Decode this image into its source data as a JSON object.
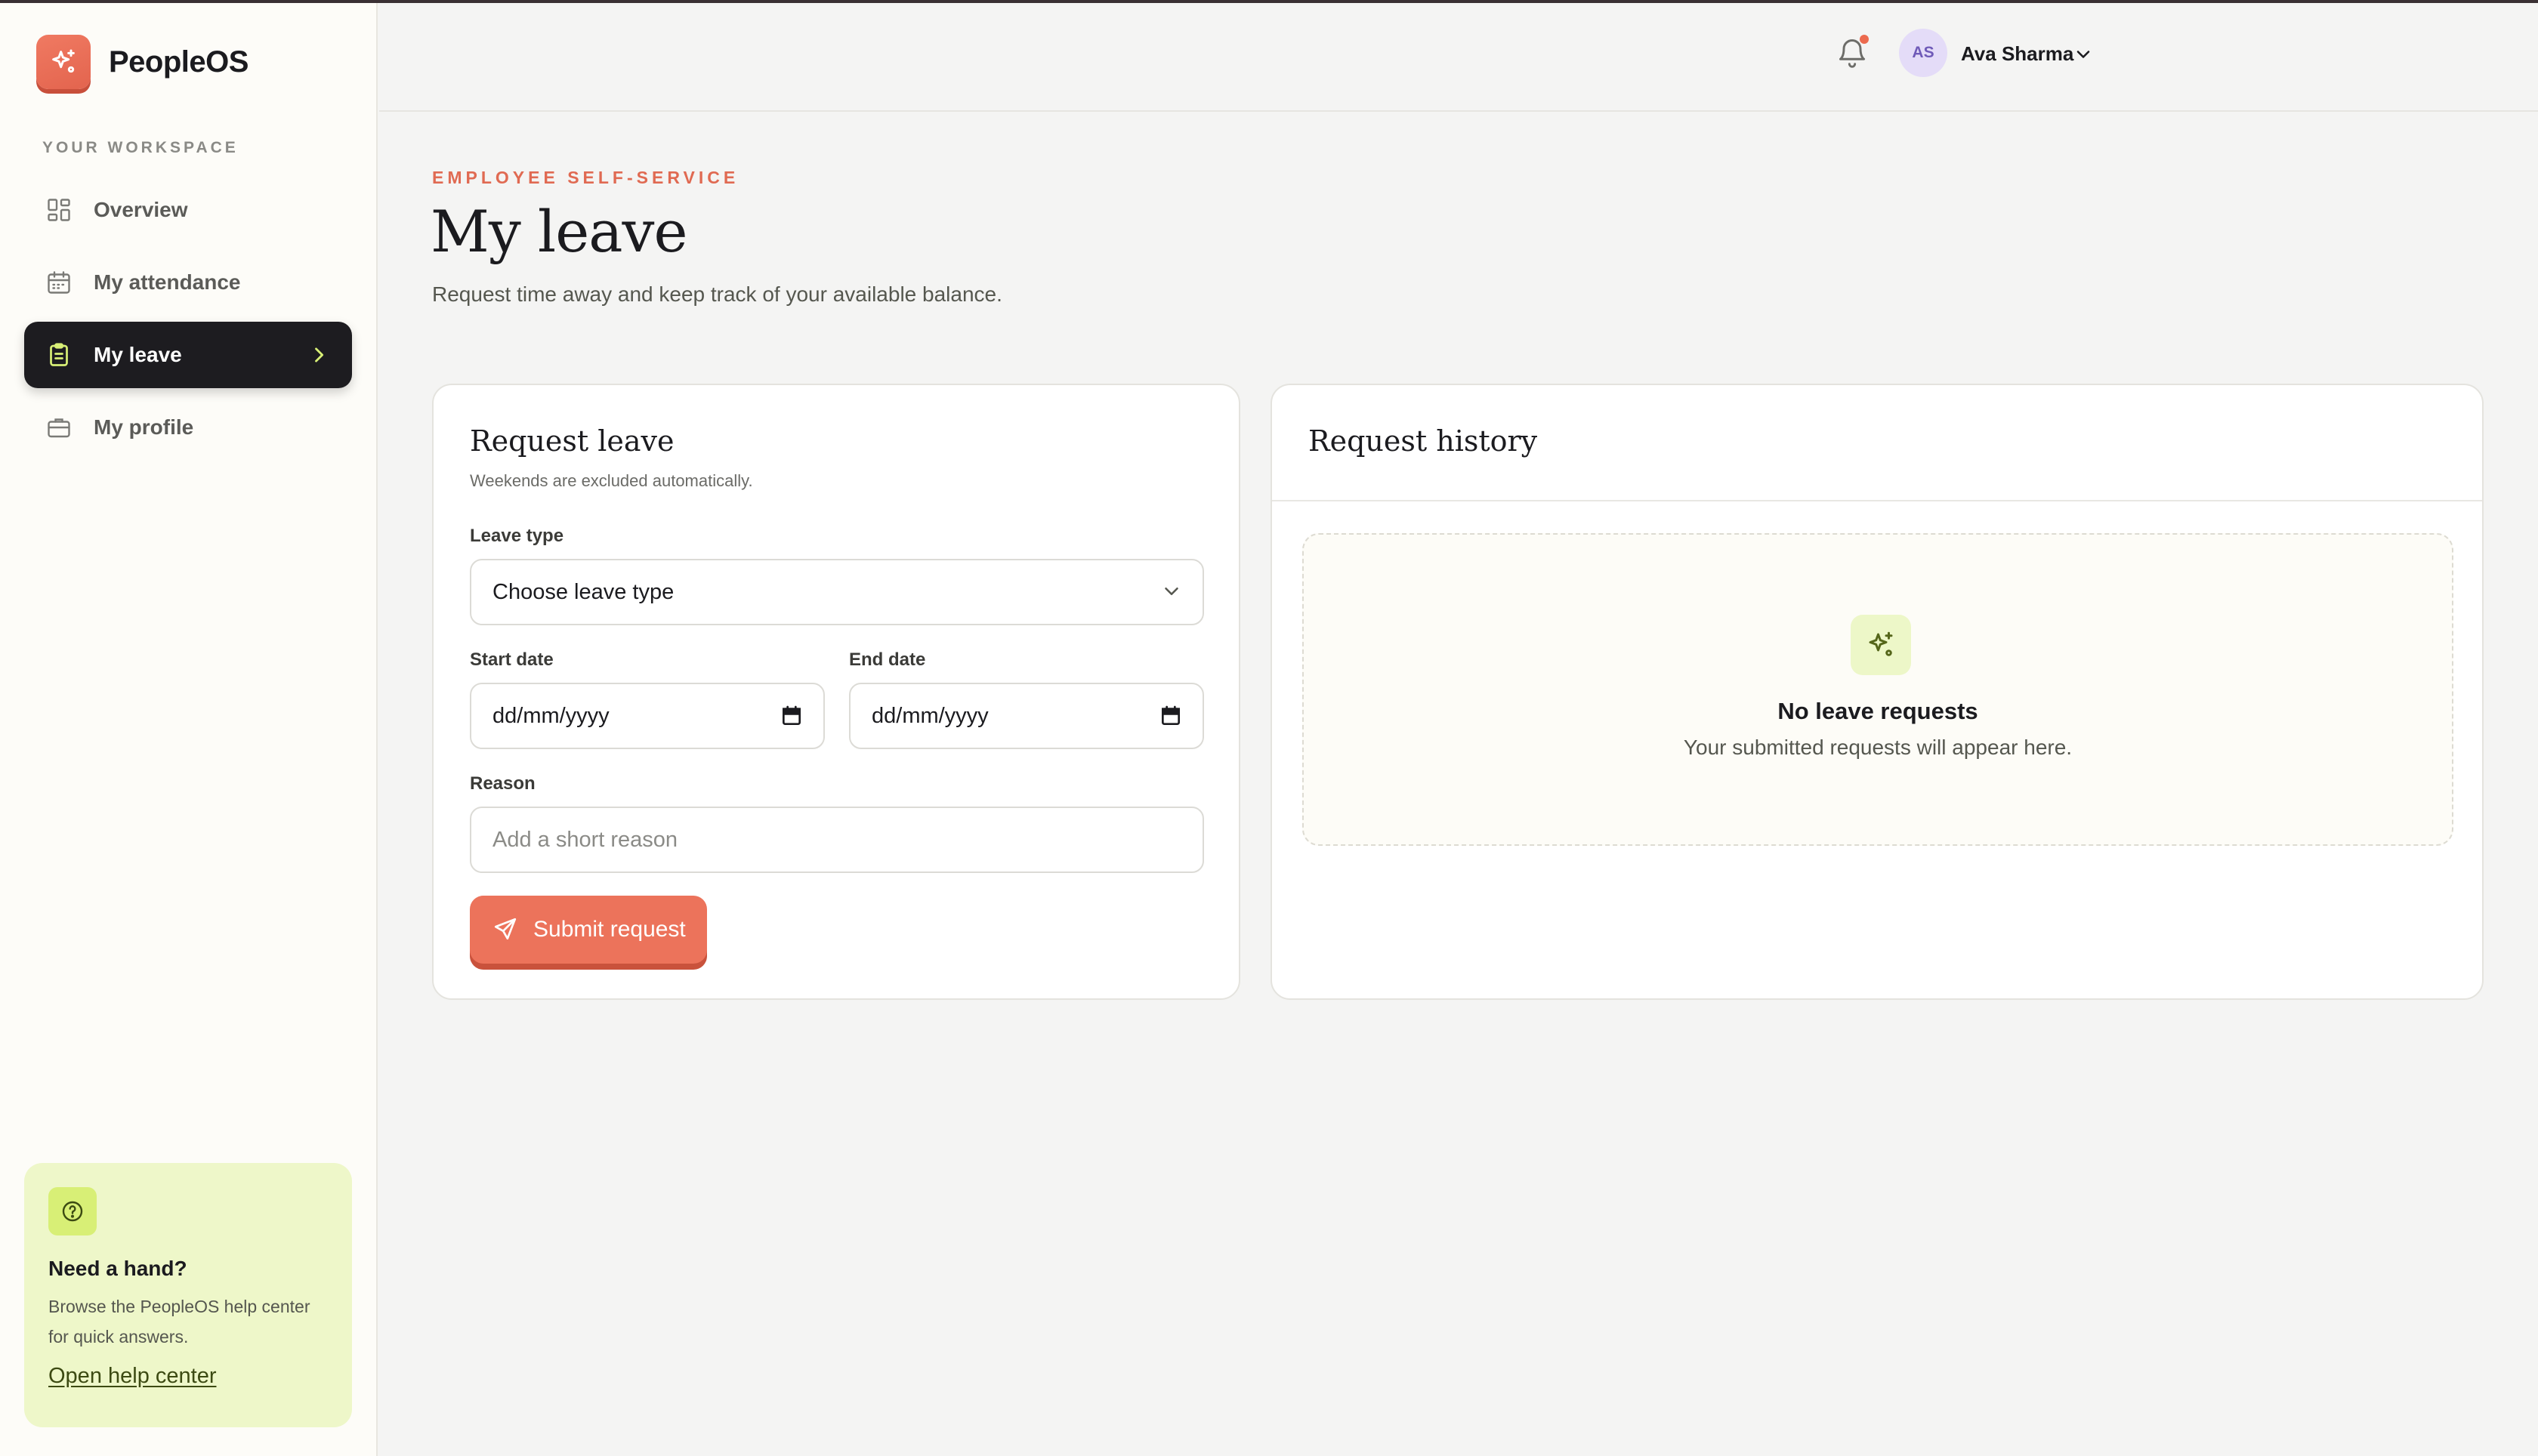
{
  "app": {
    "brand_name": "PeopleOS",
    "brand_icon": "sparkle-icon"
  },
  "sidebar": {
    "section_label": "YOUR WORKSPACE",
    "items": [
      {
        "label": "Overview",
        "icon": "dashboard-grid-icon",
        "active": false
      },
      {
        "label": "My attendance",
        "icon": "calendar-icon",
        "active": false
      },
      {
        "label": "My leave",
        "icon": "clipboard-icon",
        "active": true
      },
      {
        "label": "My profile",
        "icon": "briefcase-icon",
        "active": false
      }
    ],
    "help": {
      "icon": "question-circle-icon",
      "title": "Need a hand?",
      "text": "Browse the PeopleOS help center for quick answers.",
      "link": "Open help center"
    }
  },
  "header": {
    "notification_icon": "bell-icon",
    "has_unread": true,
    "user": {
      "initials": "AS",
      "name": "Ava Sharma"
    }
  },
  "page": {
    "eyebrow": "EMPLOYEE SELF-SERVICE",
    "title": "My leave",
    "subtitle": "Request time away and keep track of your available balance."
  },
  "request_form": {
    "title": "Request leave",
    "subtitle": "Weekends are excluded automatically.",
    "leave_type": {
      "label": "Leave type",
      "value": "Choose leave type"
    },
    "start_date": {
      "label": "Start date",
      "placeholder": "dd/mm/yyyy"
    },
    "end_date": {
      "label": "End date",
      "placeholder": "dd/mm/yyyy"
    },
    "reason": {
      "label": "Reason",
      "placeholder": "Add a short reason"
    },
    "submit_label": "Submit request"
  },
  "history": {
    "title": "Request history",
    "empty_title": "No leave requests",
    "empty_text": "Your submitted requests will appear here."
  },
  "colors": {
    "accent": "#ec735b",
    "nav_active_bg": "#1d1c20",
    "help_bg": "#eef7c9",
    "eyebrow": "#e06a52"
  }
}
